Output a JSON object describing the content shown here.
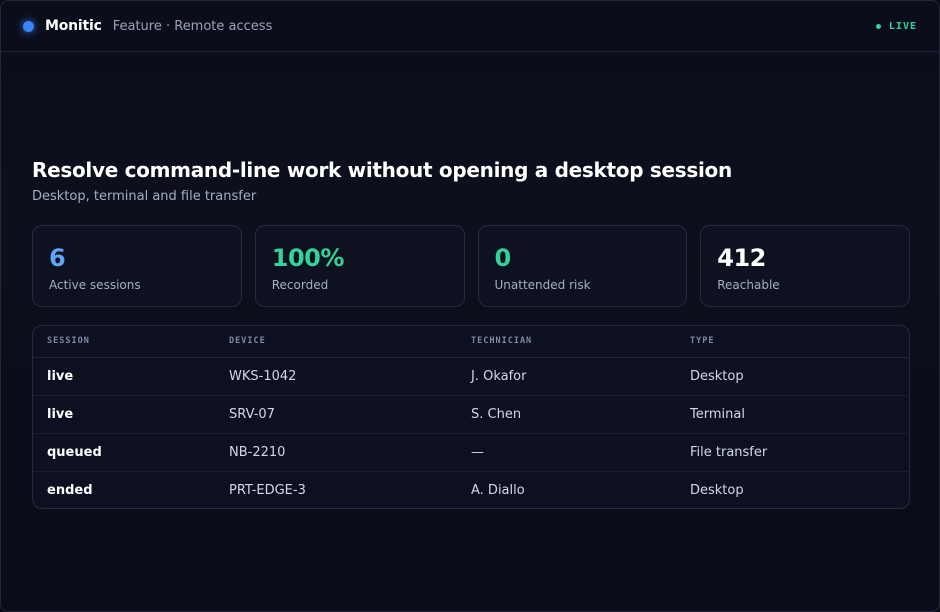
{
  "header": {
    "brand": "Monitic",
    "breadcrumb": "Feature · Remote access",
    "status": "LIVE"
  },
  "hero": {
    "title": "Resolve command-line work without opening a desktop session",
    "subtitle": "Desktop, terminal and file transfer"
  },
  "stats": [
    {
      "value": "6",
      "label": "Active sessions",
      "color": "#60a5fa"
    },
    {
      "value": "100%",
      "label": "Recorded",
      "color": "#34d399"
    },
    {
      "value": "0",
      "label": "Unattended risk",
      "color": "#34d399"
    },
    {
      "value": "412",
      "label": "Reachable",
      "color": "#ffffff"
    }
  ],
  "table": {
    "columns": [
      "SESSION",
      "DEVICE",
      "TECHNICIAN",
      "TYPE"
    ],
    "rows": [
      {
        "session": "live",
        "device": "WKS-1042",
        "technician": "J. Okafor",
        "type": "Desktop"
      },
      {
        "session": "live",
        "device": "SRV-07",
        "technician": "S. Chen",
        "type": "Terminal"
      },
      {
        "session": "queued",
        "device": "NB-2210",
        "technician": "—",
        "type": "File transfer"
      },
      {
        "session": "ended",
        "device": "PRT-EDGE-3",
        "technician": "A. Diallo",
        "type": "Desktop"
      }
    ]
  },
  "colors": {
    "accent": "#3b82f6",
    "live": "#34d399",
    "background": "#0b0e1a"
  }
}
